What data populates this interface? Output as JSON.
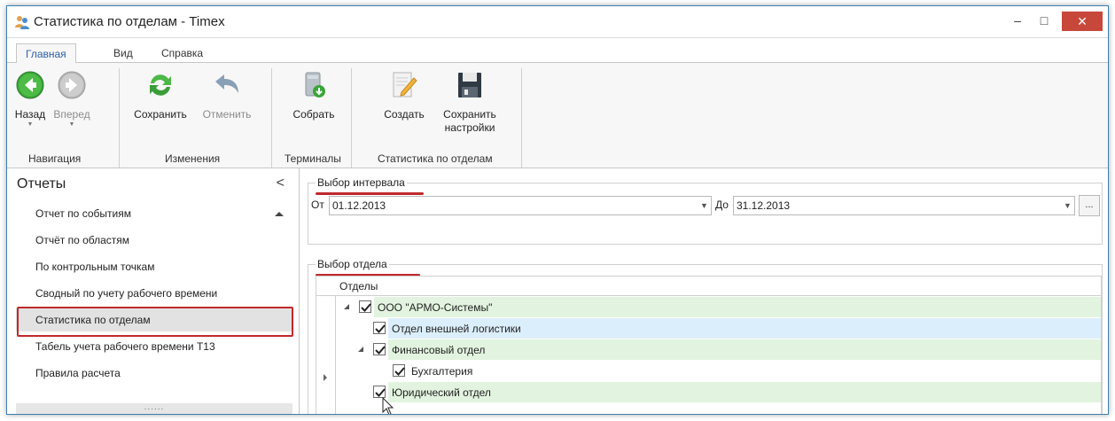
{
  "window": {
    "title": "Статистика по отделам - Timex",
    "minimize": "–",
    "maximize": "□",
    "close": "✕"
  },
  "ribbon_tabs": [
    {
      "label": "Главная",
      "active": true
    },
    {
      "label": "Вид",
      "active": false
    },
    {
      "label": "Справка",
      "active": false
    }
  ],
  "ribbon": {
    "buttons": {
      "back": {
        "label": "Назад",
        "icon": "back-arrow-icon"
      },
      "forward": {
        "label": "Вперед",
        "icon": "forward-arrow-icon"
      },
      "save": {
        "label": "Сохранить",
        "icon": "refresh-icon"
      },
      "cancel": {
        "label": "Отменить",
        "icon": "undo-icon"
      },
      "collect": {
        "label": "Собрать",
        "icon": "collect-database-icon"
      },
      "create": {
        "label": "Создать",
        "icon": "create-document-icon"
      },
      "save_settings": {
        "label_line1": "Сохранить",
        "label_line2": "настройки",
        "icon": "floppy-disk-icon"
      }
    },
    "groups": {
      "navigation": "Навигация",
      "changes": "Изменения",
      "terminals": "Терминалы",
      "dept_stats": "Статистика по отделам"
    }
  },
  "left_panel": {
    "title": "Отчеты",
    "collapse": "<",
    "items": [
      {
        "label": "Отчет по событиям"
      },
      {
        "label": "Отчёт по областям"
      },
      {
        "label": "По контрольным точкам"
      },
      {
        "label": "Сводный по учету рабочего времени"
      },
      {
        "label": "Статистика по отделам",
        "selected": true
      },
      {
        "label": "Табель учета рабочего времени Т13"
      },
      {
        "label": "Правила расчета"
      }
    ],
    "splitter": "......"
  },
  "interval": {
    "legend": "Выбор интервала",
    "from_label": "От",
    "from_value": "01.12.2013",
    "to_label": "До",
    "to_value": "31.12.2013",
    "more": "..."
  },
  "departments": {
    "legend": "Выбор отдела",
    "column_header": "Отделы",
    "rows": [
      {
        "label": "ООО \"АРМО-Системы\"",
        "checked": true,
        "expanded": true
      },
      {
        "label": "Отдел внешней логистики",
        "checked": true
      },
      {
        "label": "Финансовый отдел",
        "checked": true,
        "expanded": true
      },
      {
        "label": "Бухгалтерия",
        "checked": true
      },
      {
        "label": "Юридический отдел",
        "checked": true
      }
    ]
  },
  "colors": {
    "accent": "#2b5fa6",
    "highlight": "#c0292b",
    "row_green": "#e2f4df",
    "row_blue": "#dbeefb"
  }
}
